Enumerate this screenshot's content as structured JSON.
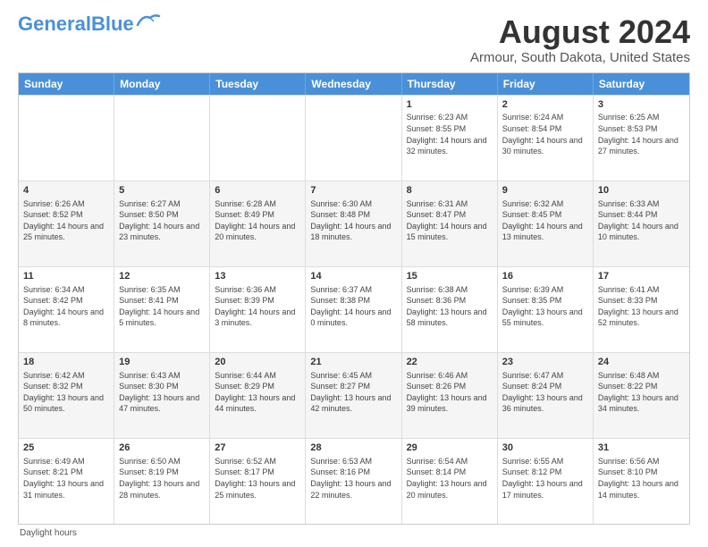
{
  "header": {
    "logo_general": "General",
    "logo_blue": "Blue",
    "main_title": "August 2024",
    "subtitle": "Armour, South Dakota, United States"
  },
  "calendar": {
    "days_of_week": [
      "Sunday",
      "Monday",
      "Tuesday",
      "Wednesday",
      "Thursday",
      "Friday",
      "Saturday"
    ],
    "rows": [
      [
        {
          "day": "",
          "info": ""
        },
        {
          "day": "",
          "info": ""
        },
        {
          "day": "",
          "info": ""
        },
        {
          "day": "",
          "info": ""
        },
        {
          "day": "1",
          "info": "Sunrise: 6:23 AM\nSunset: 8:55 PM\nDaylight: 14 hours and 32 minutes."
        },
        {
          "day": "2",
          "info": "Sunrise: 6:24 AM\nSunset: 8:54 PM\nDaylight: 14 hours and 30 minutes."
        },
        {
          "day": "3",
          "info": "Sunrise: 6:25 AM\nSunset: 8:53 PM\nDaylight: 14 hours and 27 minutes."
        }
      ],
      [
        {
          "day": "4",
          "info": "Sunrise: 6:26 AM\nSunset: 8:52 PM\nDaylight: 14 hours and 25 minutes."
        },
        {
          "day": "5",
          "info": "Sunrise: 6:27 AM\nSunset: 8:50 PM\nDaylight: 14 hours and 23 minutes."
        },
        {
          "day": "6",
          "info": "Sunrise: 6:28 AM\nSunset: 8:49 PM\nDaylight: 14 hours and 20 minutes."
        },
        {
          "day": "7",
          "info": "Sunrise: 6:30 AM\nSunset: 8:48 PM\nDaylight: 14 hours and 18 minutes."
        },
        {
          "day": "8",
          "info": "Sunrise: 6:31 AM\nSunset: 8:47 PM\nDaylight: 14 hours and 15 minutes."
        },
        {
          "day": "9",
          "info": "Sunrise: 6:32 AM\nSunset: 8:45 PM\nDaylight: 14 hours and 13 minutes."
        },
        {
          "day": "10",
          "info": "Sunrise: 6:33 AM\nSunset: 8:44 PM\nDaylight: 14 hours and 10 minutes."
        }
      ],
      [
        {
          "day": "11",
          "info": "Sunrise: 6:34 AM\nSunset: 8:42 PM\nDaylight: 14 hours and 8 minutes."
        },
        {
          "day": "12",
          "info": "Sunrise: 6:35 AM\nSunset: 8:41 PM\nDaylight: 14 hours and 5 minutes."
        },
        {
          "day": "13",
          "info": "Sunrise: 6:36 AM\nSunset: 8:39 PM\nDaylight: 14 hours and 3 minutes."
        },
        {
          "day": "14",
          "info": "Sunrise: 6:37 AM\nSunset: 8:38 PM\nDaylight: 14 hours and 0 minutes."
        },
        {
          "day": "15",
          "info": "Sunrise: 6:38 AM\nSunset: 8:36 PM\nDaylight: 13 hours and 58 minutes."
        },
        {
          "day": "16",
          "info": "Sunrise: 6:39 AM\nSunset: 8:35 PM\nDaylight: 13 hours and 55 minutes."
        },
        {
          "day": "17",
          "info": "Sunrise: 6:41 AM\nSunset: 8:33 PM\nDaylight: 13 hours and 52 minutes."
        }
      ],
      [
        {
          "day": "18",
          "info": "Sunrise: 6:42 AM\nSunset: 8:32 PM\nDaylight: 13 hours and 50 minutes."
        },
        {
          "day": "19",
          "info": "Sunrise: 6:43 AM\nSunset: 8:30 PM\nDaylight: 13 hours and 47 minutes."
        },
        {
          "day": "20",
          "info": "Sunrise: 6:44 AM\nSunset: 8:29 PM\nDaylight: 13 hours and 44 minutes."
        },
        {
          "day": "21",
          "info": "Sunrise: 6:45 AM\nSunset: 8:27 PM\nDaylight: 13 hours and 42 minutes."
        },
        {
          "day": "22",
          "info": "Sunrise: 6:46 AM\nSunset: 8:26 PM\nDaylight: 13 hours and 39 minutes."
        },
        {
          "day": "23",
          "info": "Sunrise: 6:47 AM\nSunset: 8:24 PM\nDaylight: 13 hours and 36 minutes."
        },
        {
          "day": "24",
          "info": "Sunrise: 6:48 AM\nSunset: 8:22 PM\nDaylight: 13 hours and 34 minutes."
        }
      ],
      [
        {
          "day": "25",
          "info": "Sunrise: 6:49 AM\nSunset: 8:21 PM\nDaylight: 13 hours and 31 minutes."
        },
        {
          "day": "26",
          "info": "Sunrise: 6:50 AM\nSunset: 8:19 PM\nDaylight: 13 hours and 28 minutes."
        },
        {
          "day": "27",
          "info": "Sunrise: 6:52 AM\nSunset: 8:17 PM\nDaylight: 13 hours and 25 minutes."
        },
        {
          "day": "28",
          "info": "Sunrise: 6:53 AM\nSunset: 8:16 PM\nDaylight: 13 hours and 22 minutes."
        },
        {
          "day": "29",
          "info": "Sunrise: 6:54 AM\nSunset: 8:14 PM\nDaylight: 13 hours and 20 minutes."
        },
        {
          "day": "30",
          "info": "Sunrise: 6:55 AM\nSunset: 8:12 PM\nDaylight: 13 hours and 17 minutes."
        },
        {
          "day": "31",
          "info": "Sunrise: 6:56 AM\nSunset: 8:10 PM\nDaylight: 13 hours and 14 minutes."
        }
      ]
    ],
    "footer_note": "Daylight hours"
  }
}
